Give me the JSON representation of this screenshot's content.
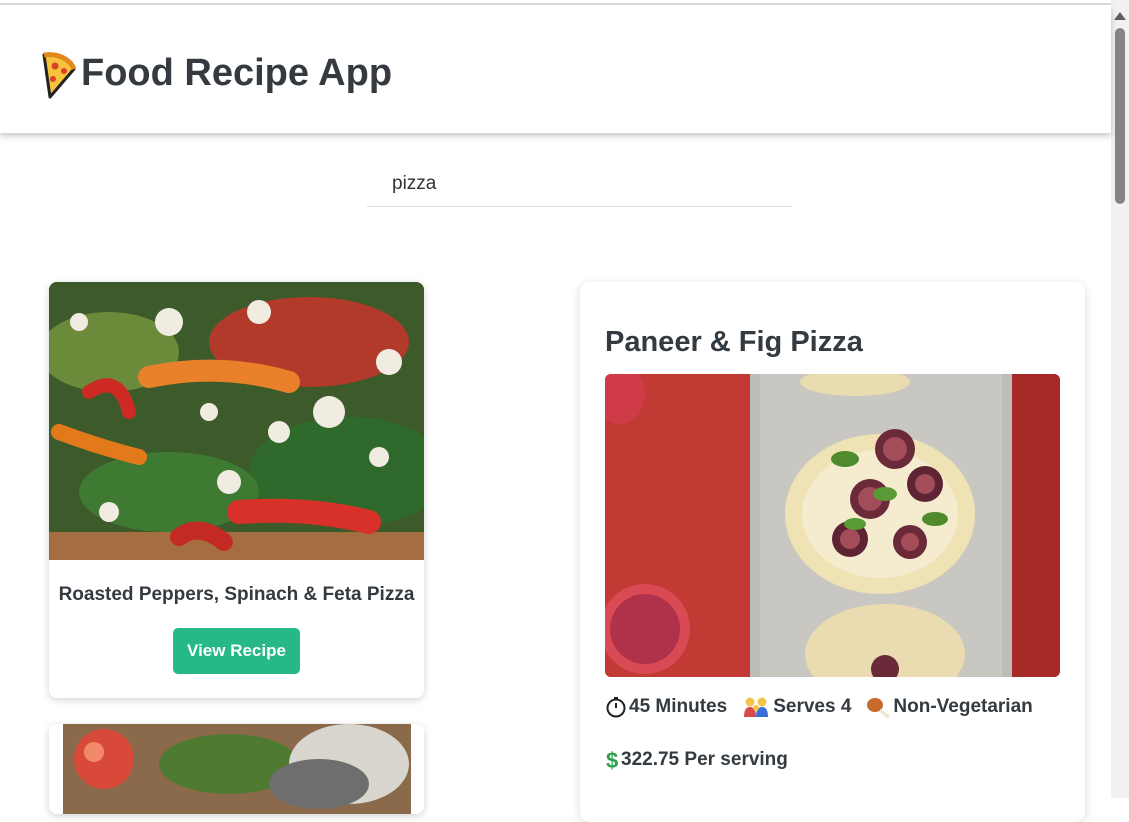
{
  "header": {
    "title": "Food Recipe App",
    "icon": "pizza-slice-icon"
  },
  "search": {
    "value": "pizza"
  },
  "results": [
    {
      "title": "Roasted Peppers, Spinach & Feta Pizza",
      "button_label": "View Recipe"
    },
    {
      "title": ""
    }
  ],
  "detail": {
    "title": "Paneer & Fig Pizza",
    "time_label": "45 Minutes",
    "serves_label": "Serves 4",
    "diet_label": "Non-Vegetarian",
    "price_label": "322.75 Per serving"
  },
  "colors": {
    "accent": "#27b887",
    "title": "#343a40"
  }
}
